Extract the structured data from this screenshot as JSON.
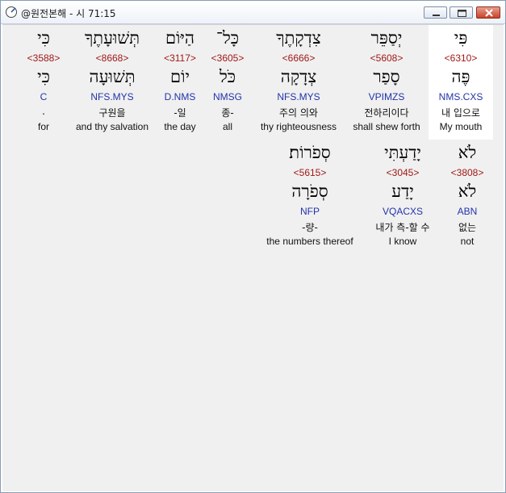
{
  "window": {
    "title": "@원전본해 - 시 71:15"
  },
  "rows": [
    {
      "words": [
        {
          "hebrew": "פִּי",
          "strong": "<6310>",
          "lemma": "פֶּה",
          "parse": "NMS.CXS",
          "korean": "내 입으로",
          "english": "My mouth",
          "highlighted": true
        },
        {
          "hebrew": "יְסַפֵּר",
          "strong": "<5608>",
          "lemma": "סָפַר",
          "parse": "VPIMZS",
          "korean": "전하리이다",
          "english": "shall shew forth"
        },
        {
          "hebrew": "צִדְקָתֶךָ",
          "strong": "<6666>",
          "lemma": "צְדָקָה",
          "parse": "NFS.MYS",
          "korean": "주의 의와",
          "english": "thy righteousness"
        },
        {
          "hebrew": "כָּל־",
          "strong": "<3605>",
          "lemma": "כֹּל",
          "parse": "NMSG",
          "korean": "종-",
          "english": "all"
        },
        {
          "hebrew": "הַיּוֹם",
          "strong": "<3117>",
          "lemma": "יוֹם",
          "parse": "D.NMS",
          "korean": "-일",
          "english": "the day"
        },
        {
          "hebrew": "תְּשׁוּעָתֶךָ",
          "strong": "<8668>",
          "lemma": "תְּשׁוּעָה",
          "parse": "NFS.MYS",
          "korean": "구원을",
          "english": "and thy salvation"
        },
        {
          "hebrew": "כִּי",
          "strong": "<3588>",
          "lemma": "כִּי",
          "parse": "C",
          "korean": ".",
          "english": "for"
        }
      ]
    },
    {
      "words": [
        {
          "hebrew": "לֹא",
          "strong": "<3808>",
          "lemma": "לֹא",
          "parse": "ABN",
          "korean": "없는",
          "english": "not"
        },
        {
          "hebrew": "יָדַעְתִּי",
          "strong": "<3045>",
          "lemma": "יָדַע",
          "parse": "VQACXS",
          "korean": "내가 측-할 수",
          "english": "I know"
        },
        {
          "hebrew": "סְפֹרוֹת׃",
          "strong": "<5615>",
          "lemma": "סְפֹרָה",
          "parse": "NFP",
          "korean": "-량-",
          "english": "the numbers thereof"
        }
      ]
    }
  ]
}
